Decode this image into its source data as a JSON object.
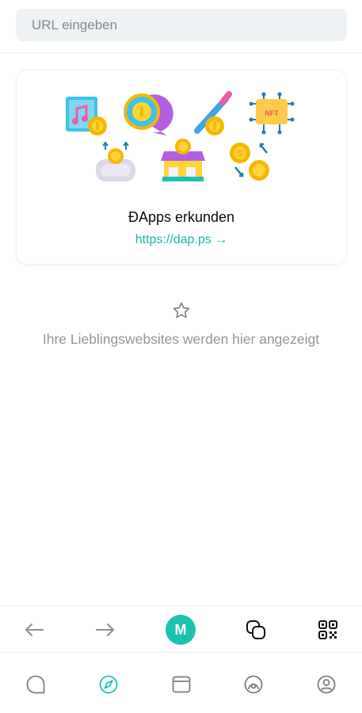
{
  "url_bar": {
    "placeholder": "URL eingeben",
    "value": ""
  },
  "dapps_card": {
    "title": "ĐApps erkunden",
    "link": "https://dap.ps →",
    "nft_label": "NFT"
  },
  "favorites": {
    "empty_text": "Ihre Lieblingswebsites werden hier angezeigt"
  },
  "browser_nav": {
    "account_initial": "M",
    "accent_color": "#1cc2b0"
  },
  "bottom_tabs": {
    "active": "browser",
    "items": [
      "chat",
      "browser",
      "wallet",
      "activity",
      "profile"
    ]
  }
}
